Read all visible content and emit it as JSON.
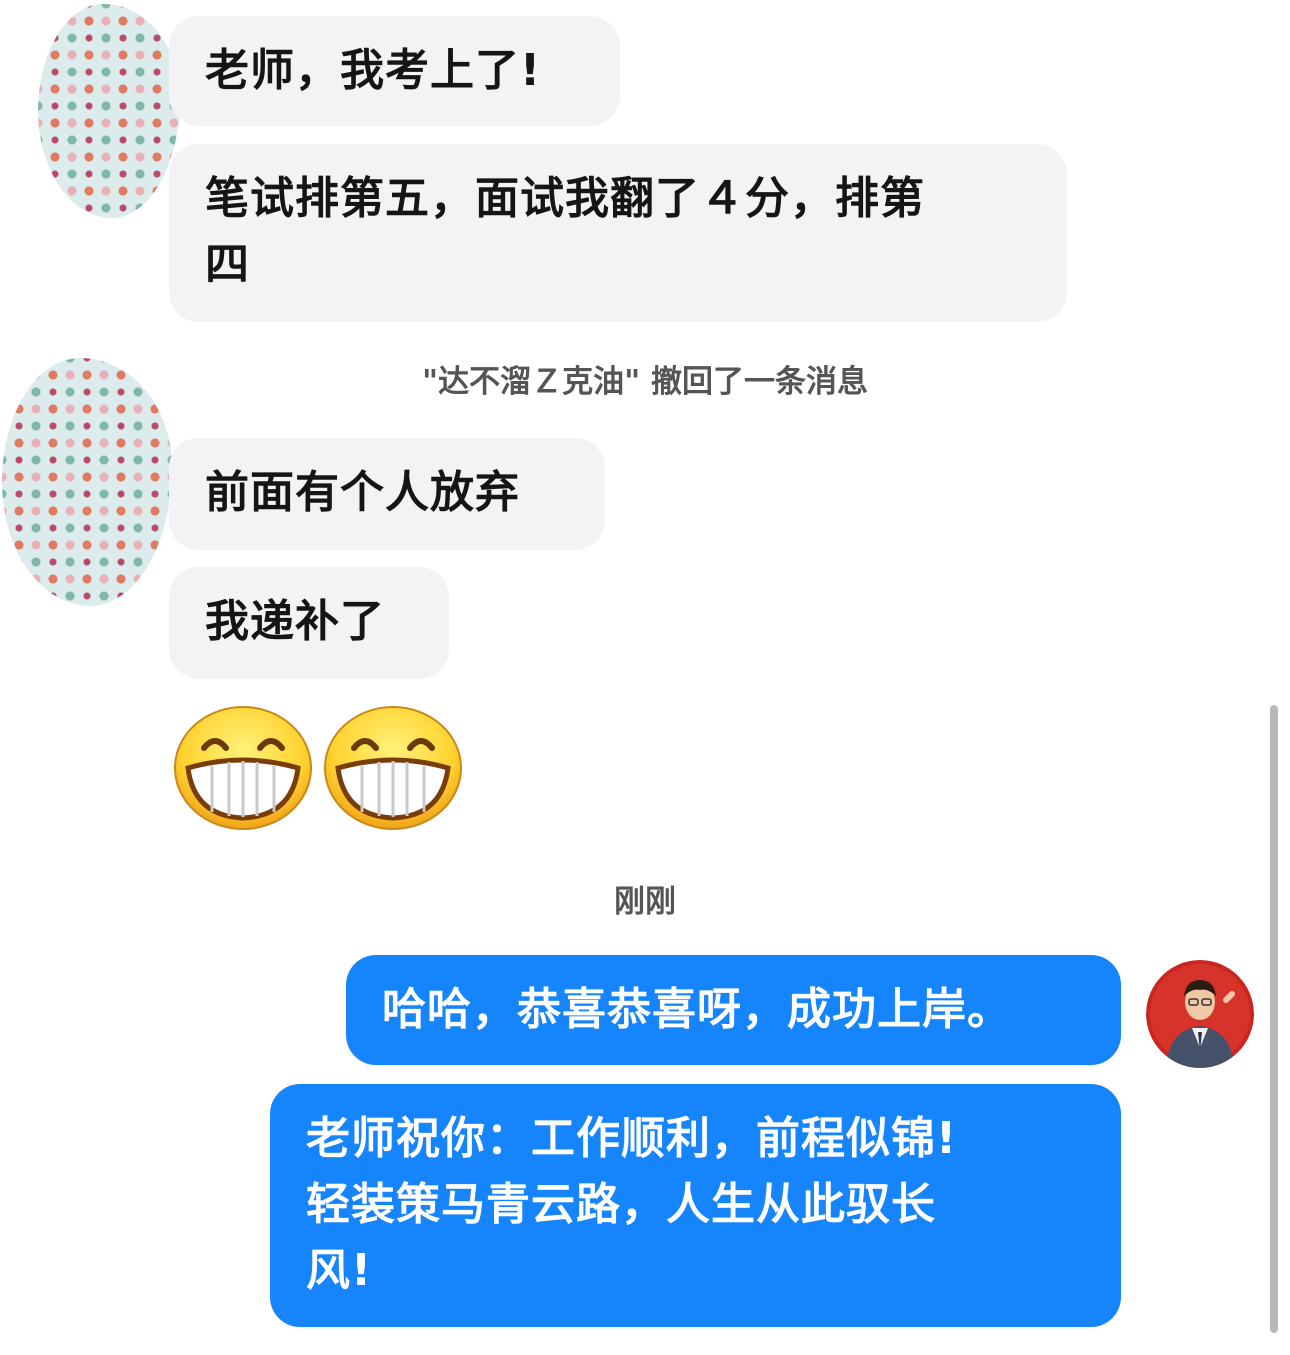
{
  "messages": {
    "m1": "老师，我考上了!",
    "m2_line1": "笔试排第五，面试我翻了４分，排第",
    "m2_line2": "四",
    "recalled_notice": "\"达不溜Ｚ克油\" 撤回了一条消息",
    "m3": "前面有个人放弃",
    "m4": "我递补了",
    "timestamp": "刚刚",
    "reply1": "哈哈，恭喜恭喜呀，成功上岸。",
    "reply2_line1": "老师祝你：工作顺利，前程似锦!",
    "reply2_line2": "轻装策马青云路，人生从此驭长",
    "reply2_line3": "风!"
  },
  "colors": {
    "incoming_bubble": "#f3f3f5",
    "outgoing_bubble": "#1685fb",
    "teacher_avatar_bg": "#c8261f"
  },
  "emojis": [
    "grin-emoji",
    "grin-emoji"
  ]
}
